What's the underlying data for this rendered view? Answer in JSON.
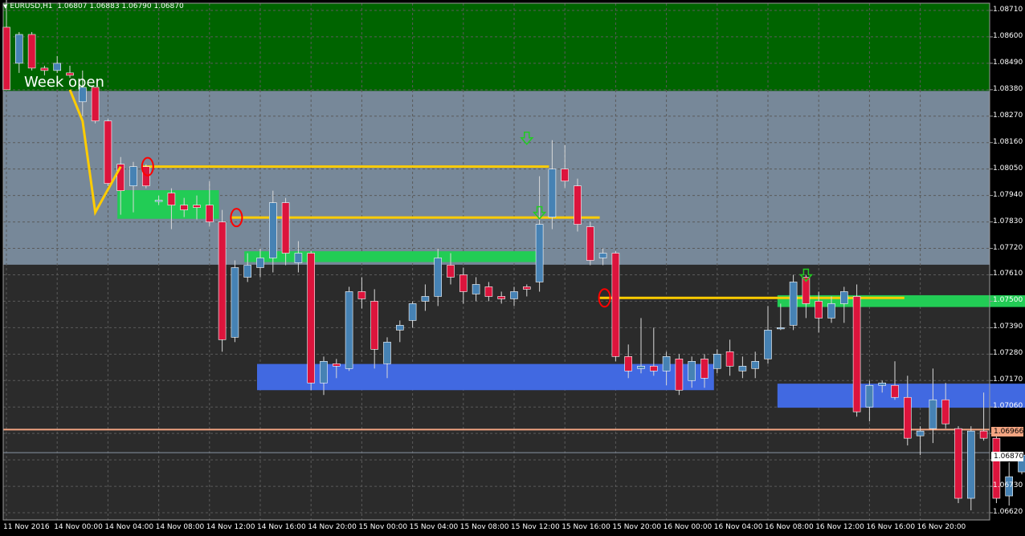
{
  "header": {
    "symbol": "EURUSD,H1",
    "ohlc": "1.06807 1.06883 1.06790 1.06870"
  },
  "annotations": {
    "week_open": "Week open"
  },
  "price_axis": {
    "labels": [
      "1.08710",
      "1.08600",
      "1.08490",
      "1.08380",
      "1.08270",
      "1.08160",
      "1.08050",
      "1.07940",
      "1.07830",
      "1.07720",
      "1.07610",
      "1.07500",
      "1.07390",
      "1.07280",
      "1.07170",
      "1.07060",
      "1.06950",
      "1.06840",
      "1.06730",
      "1.06620"
    ]
  },
  "price_tags": {
    "level": "1.06966",
    "last": "1.06870"
  },
  "time_axis": {
    "labels": [
      "11 Nov 2016",
      "14 Nov 00:00",
      "14 Nov 04:00",
      "14 Nov 08:00",
      "14 Nov 12:00",
      "14 Nov 16:00",
      "14 Nov 20:00",
      "15 Nov 00:00",
      "15 Nov 04:00",
      "15 Nov 08:00",
      "15 Nov 12:00",
      "15 Nov 16:00",
      "15 Nov 20:00",
      "16 Nov 00:00",
      "16 Nov 04:00",
      "16 Nov 08:00",
      "16 Nov 12:00",
      "16 Nov 16:00",
      "16 Nov 20:00"
    ]
  },
  "colors": {
    "background": "#000000",
    "plot_bg": "#2b2b2b",
    "supply_zone": "#006400",
    "gray_zone": "#778899",
    "bull_candle": "#4682b4",
    "bear_candle": "#dc143c",
    "demand_green": "#22cc55",
    "demand_blue": "#4169e1",
    "level_line": "#ffcc00",
    "marker": "#ff0000",
    "arrow": "#22cc22",
    "level_tag": "#f4a582"
  },
  "chart_data": {
    "type": "candlestick",
    "symbol": "EURUSD",
    "timeframe": "H1",
    "ylim": [
      1.0659,
      1.0874
    ],
    "x_start": "11 Nov 2016",
    "candles": [
      [
        1.0864,
        1.0876,
        1.0838,
        1.0838
      ],
      [
        1.0849,
        1.0862,
        1.0845,
        1.0861
      ],
      [
        1.0861,
        1.0862,
        1.0846,
        1.0847
      ],
      [
        1.0847,
        1.0848,
        1.0844,
        1.0846
      ],
      [
        1.0846,
        1.0852,
        1.0845,
        1.0849
      ],
      [
        1.0845,
        1.0848,
        1.0843,
        1.0844
      ],
      [
        1.0833,
        1.0846,
        1.0827,
        1.0839
      ],
      [
        1.0839,
        1.0839,
        1.0824,
        1.0825
      ],
      [
        1.0825,
        1.0826,
        1.0798,
        1.0799
      ],
      [
        1.0807,
        1.081,
        1.0786,
        1.0796
      ],
      [
        1.0798,
        1.0808,
        1.0787,
        1.0806
      ],
      [
        1.0806,
        1.0807,
        1.0797,
        1.0798
      ],
      [
        1.0792,
        1.0794,
        1.079,
        1.0792
      ],
      [
        1.0795,
        1.0797,
        1.078,
        1.079
      ],
      [
        1.079,
        1.0793,
        1.0785,
        1.0788
      ],
      [
        1.079,
        1.0794,
        1.0784,
        1.0789
      ],
      [
        1.079,
        1.08,
        1.0781,
        1.0783
      ],
      [
        1.0783,
        1.0788,
        1.0729,
        1.0734
      ],
      [
        1.0735,
        1.0767,
        1.0733,
        1.0764
      ],
      [
        1.076,
        1.077,
        1.0758,
        1.0765
      ],
      [
        1.0764,
        1.0772,
        1.076,
        1.0768
      ],
      [
        1.0768,
        1.0796,
        1.0762,
        1.0791
      ],
      [
        1.0791,
        1.0793,
        1.0765,
        1.077
      ],
      [
        1.0766,
        1.0775,
        1.0762,
        1.077
      ],
      [
        1.077,
        1.0771,
        1.0713,
        1.0716
      ],
      [
        1.0716,
        1.0727,
        1.0711,
        1.0725
      ],
      [
        1.0724,
        1.0726,
        1.0718,
        1.0723
      ],
      [
        1.0722,
        1.0756,
        1.0721,
        1.0754
      ],
      [
        1.0754,
        1.076,
        1.0747,
        1.0751
      ],
      [
        1.075,
        1.0755,
        1.0722,
        1.073
      ],
      [
        1.0724,
        1.0735,
        1.0718,
        1.0733
      ],
      [
        1.0738,
        1.0742,
        1.0733,
        1.074
      ],
      [
        1.0742,
        1.075,
        1.0739,
        1.0749
      ],
      [
        1.075,
        1.0757,
        1.0746,
        1.0752
      ],
      [
        1.0752,
        1.0772,
        1.0748,
        1.0768
      ],
      [
        1.0765,
        1.077,
        1.0757,
        1.076
      ],
      [
        1.0761,
        1.0764,
        1.0749,
        1.0754
      ],
      [
        1.0753,
        1.076,
        1.075,
        1.0757
      ],
      [
        1.0756,
        1.0758,
        1.075,
        1.0752
      ],
      [
        1.0752,
        1.0754,
        1.0749,
        1.0751
      ],
      [
        1.0751,
        1.0756,
        1.0748,
        1.0754
      ],
      [
        1.0756,
        1.0757,
        1.0752,
        1.0755
      ],
      [
        1.0758,
        1.0802,
        1.0754,
        1.0782
      ],
      [
        1.0785,
        1.0817,
        1.078,
        1.0805
      ],
      [
        1.0805,
        1.0815,
        1.0797,
        1.08
      ],
      [
        1.0798,
        1.0801,
        1.0779,
        1.0782
      ],
      [
        1.0781,
        1.0783,
        1.0765,
        1.0767
      ],
      [
        1.0768,
        1.0772,
        1.0765,
        1.077
      ],
      [
        1.077,
        1.0771,
        1.0725,
        1.0727
      ],
      [
        1.0727,
        1.0732,
        1.0718,
        1.0721
      ],
      [
        1.0722,
        1.0743,
        1.072,
        1.0723
      ],
      [
        1.0723,
        1.0739,
        1.0719,
        1.0721
      ],
      [
        1.0721,
        1.0729,
        1.0715,
        1.0727
      ],
      [
        1.0726,
        1.0728,
        1.0711,
        1.0713
      ],
      [
        1.0717,
        1.0727,
        1.0714,
        1.0725
      ],
      [
        1.0726,
        1.0728,
        1.0714,
        1.0718
      ],
      [
        1.0722,
        1.073,
        1.072,
        1.0728
      ],
      [
        1.0729,
        1.0734,
        1.0719,
        1.0723
      ],
      [
        1.0721,
        1.0727,
        1.0718,
        1.0723
      ],
      [
        1.0722,
        1.0729,
        1.0718,
        1.0725
      ],
      [
        1.0726,
        1.0748,
        1.0724,
        1.0738
      ],
      [
        1.0739,
        1.0749,
        1.0738,
        1.0739
      ],
      [
        1.074,
        1.0761,
        1.0738,
        1.0758
      ],
      [
        1.076,
        1.0761,
        1.0743,
        1.0749
      ],
      [
        1.075,
        1.0754,
        1.0737,
        1.0743
      ],
      [
        1.0743,
        1.0752,
        1.0741,
        1.0749
      ],
      [
        1.0749,
        1.0756,
        1.0741,
        1.0754
      ],
      [
        1.0752,
        1.0757,
        1.0702,
        1.0704
      ],
      [
        1.0706,
        1.0717,
        1.07,
        1.0715
      ],
      [
        1.0715,
        1.0717,
        1.0712,
        1.0716
      ],
      [
        1.0715,
        1.0725,
        1.0709,
        1.071
      ],
      [
        1.071,
        1.0719,
        1.069,
        1.0693
      ],
      [
        1.0694,
        1.0698,
        1.0686,
        1.0696
      ],
      [
        1.0697,
        1.0722,
        1.0691,
        1.0709
      ],
      [
        1.0709,
        1.0716,
        1.0697,
        1.0699
      ],
      [
        1.0697,
        1.0698,
        1.0666,
        1.0668
      ],
      [
        1.0668,
        1.0698,
        1.0663,
        1.0696
      ],
      [
        1.0696,
        1.0712,
        1.0692,
        1.0693
      ],
      [
        1.0693,
        1.0696,
        1.0666,
        1.0668
      ],
      [
        1.0669,
        1.0683,
        1.0665,
        1.0677
      ],
      [
        1.0679,
        1.0686,
        1.0678,
        1.0686
      ]
    ],
    "zones": [
      {
        "name": "supply-zone-upper",
        "from": 1.08375,
        "to": 1.0874,
        "color": "#006400"
      },
      {
        "name": "gray-range-zone",
        "from": 1.07652,
        "to": 1.08375,
        "color": "#778899"
      },
      {
        "name": "demand-zone-green-left",
        "from": 1.07843,
        "to": 1.07962,
        "start": 9,
        "end": 17
      },
      {
        "name": "demand-zone-green-mid",
        "from": 1.07663,
        "to": 1.07708,
        "start": 19,
        "end": 42
      },
      {
        "name": "demand-zone-blue-mid",
        "from": 1.0713,
        "to": 1.07239,
        "start": 20,
        "end": 56
      },
      {
        "name": "demand-zone-green-right",
        "from": 1.07476,
        "to": 1.07525,
        "start": 61,
        "end": 83
      },
      {
        "name": "demand-zone-blue-right",
        "from": 1.07057,
        "to": 1.07157,
        "start": 61,
        "end": 83
      }
    ],
    "level_lines": [
      1.06966,
      1.0687
    ],
    "yellow_lines": [
      {
        "price": 1.0806,
        "start": 11,
        "end": 43
      },
      {
        "price": 1.07848,
        "start": 18,
        "end": 47
      },
      {
        "price": 1.07514,
        "start": 47,
        "end": 71
      }
    ],
    "circles": [
      {
        "price": 1.0806,
        "index": 11
      },
      {
        "price": 1.07848,
        "index": 18
      },
      {
        "price": 1.07514,
        "index": 47
      }
    ],
    "arrows": [
      {
        "price": 1.0817,
        "index": 41
      },
      {
        "price": 1.0786,
        "index": 42
      },
      {
        "price": 1.076,
        "index": 63
      }
    ]
  }
}
